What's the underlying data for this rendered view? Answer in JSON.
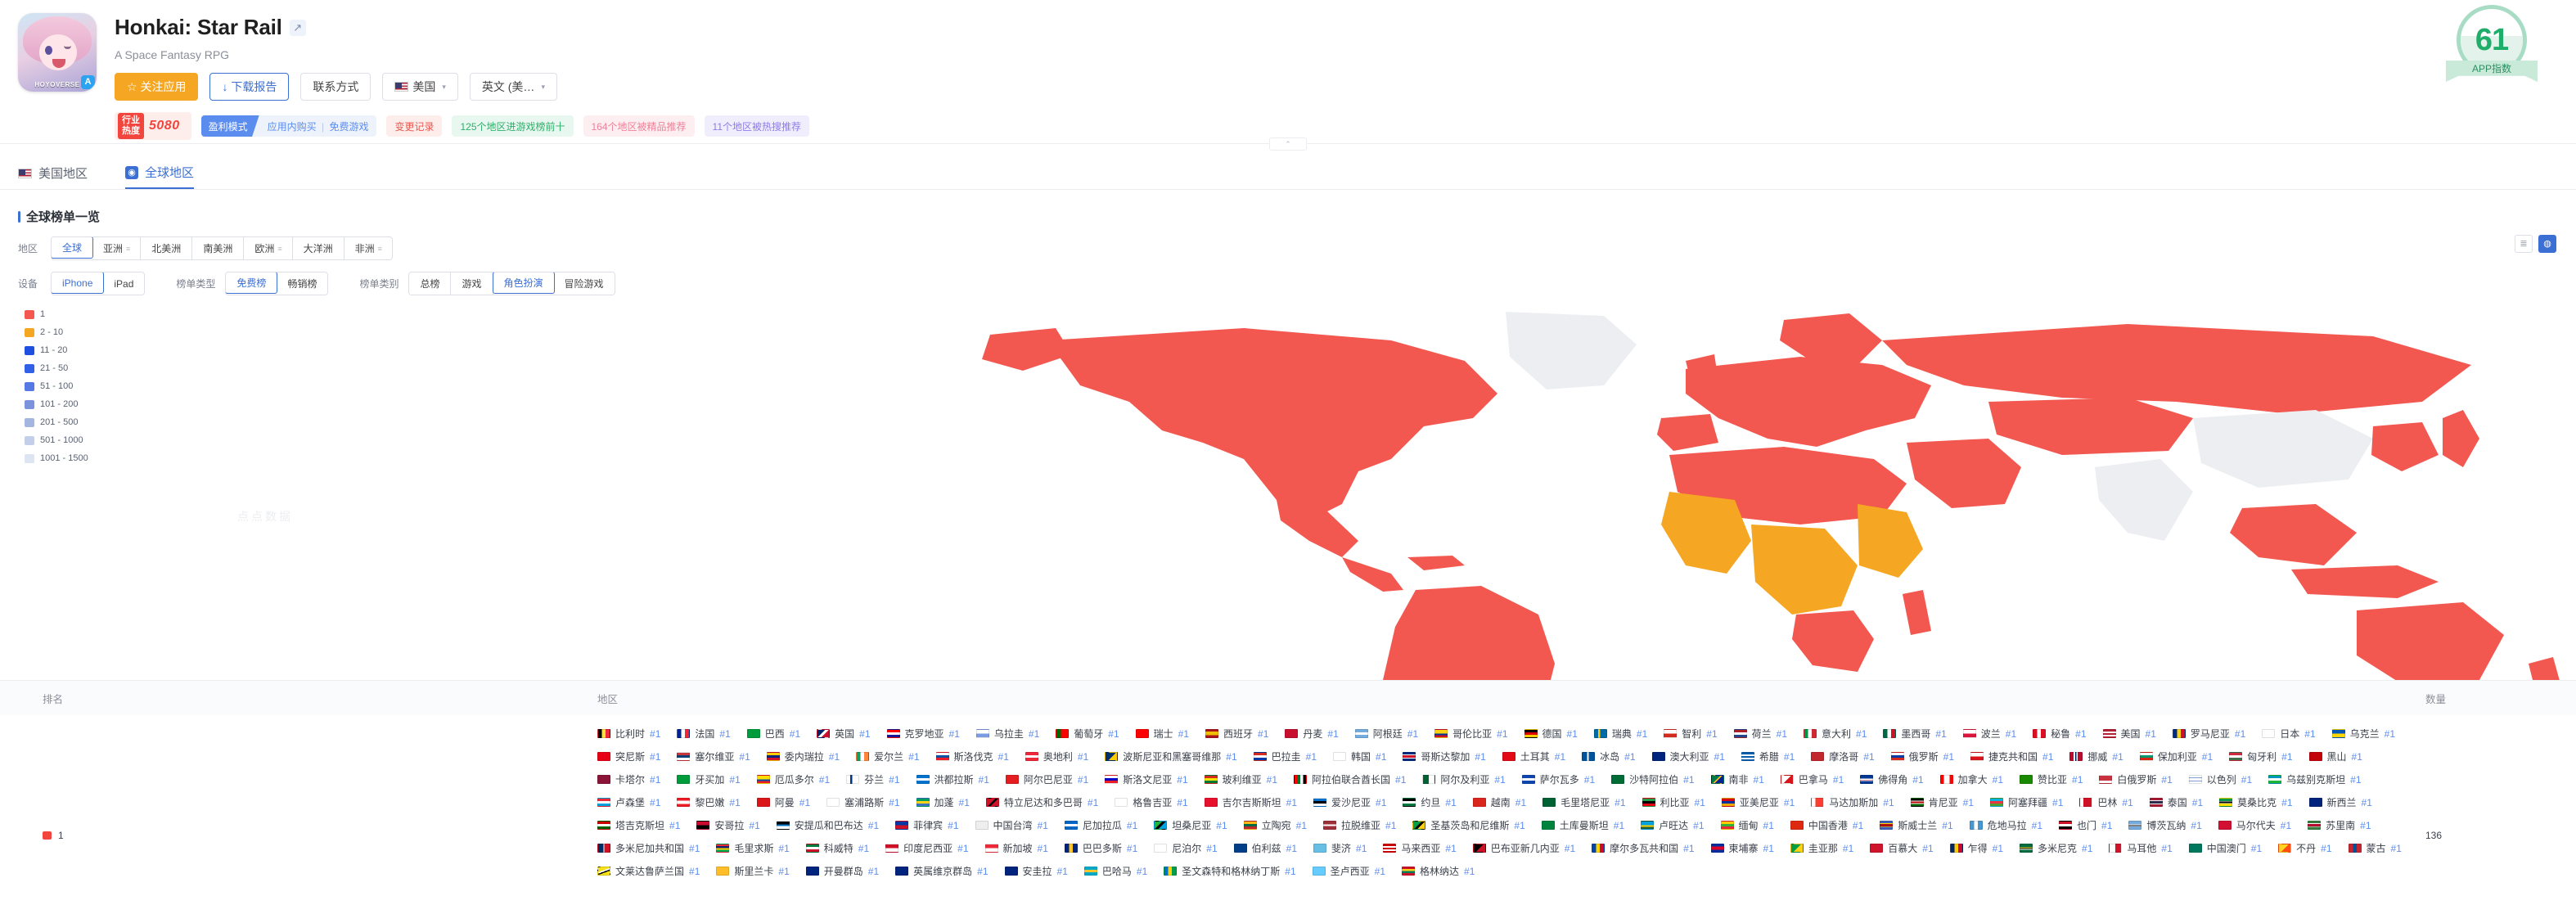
{
  "header": {
    "app_title": "Honkai: Star Rail",
    "external_link_icon": "external-link-icon",
    "subtitle": "A Space Fantasy RPG",
    "icon_brand": "HOYOVERSE",
    "store_badge": "A",
    "buttons": {
      "follow": "☆ 关注应用",
      "download_report": "↓ 下载报告",
      "contact": "联系方式",
      "country": "美国",
      "language": "英文 (美…"
    },
    "heat": {
      "label_top": "行业",
      "label_bottom": "热度",
      "value": "5080"
    },
    "tags": {
      "monetization_key": "盈利模式",
      "monetization_val_1": "应用内购买",
      "monetization_sep": "|",
      "monetization_val_2": "免费游戏",
      "changelog": "变更记录",
      "top_ten": "125个地区进游戏榜前十",
      "featured": "164个地区被精品推荐",
      "trending": "11个地区被热搜推荐"
    },
    "score": {
      "value": "61",
      "label": "APP指数"
    },
    "collapse": "⌃"
  },
  "region_tabs": [
    {
      "label": "美国地区",
      "icon": "us-flag-icon",
      "active": false
    },
    {
      "label": "全球地区",
      "icon": "globe-icon",
      "active": true
    }
  ],
  "section": {
    "title": "全球榜单一览"
  },
  "filters": {
    "region": {
      "label": "地区",
      "options": [
        {
          "label": "全球",
          "active": true,
          "has_menu": false
        },
        {
          "label": "亚洲",
          "active": false,
          "has_menu": true
        },
        {
          "label": "北美洲",
          "active": false,
          "has_menu": false
        },
        {
          "label": "南美洲",
          "active": false,
          "has_menu": false
        },
        {
          "label": "欧洲",
          "active": false,
          "has_menu": true
        },
        {
          "label": "大洋洲",
          "active": false,
          "has_menu": false
        },
        {
          "label": "非洲",
          "active": false,
          "has_menu": true
        }
      ]
    },
    "device": {
      "label": "设备",
      "options": [
        {
          "label": "iPhone",
          "active": true
        },
        {
          "label": "iPad",
          "active": false
        }
      ]
    },
    "chart_type": {
      "label": "榜单类型",
      "options": [
        {
          "label": "免费榜",
          "active": true
        },
        {
          "label": "畅销榜",
          "active": false
        }
      ]
    },
    "chart_category": {
      "label": "榜单类别",
      "options": [
        {
          "label": "总榜",
          "active": false
        },
        {
          "label": "游戏",
          "active": false
        },
        {
          "label": "角色扮演",
          "active": true
        },
        {
          "label": "冒险游戏",
          "active": false
        }
      ]
    },
    "view_toggle": [
      {
        "icon": "list-view-icon",
        "active": false
      },
      {
        "icon": "map-view-icon",
        "active": true
      }
    ]
  },
  "map": {
    "watermark": "点点数据",
    "legend": [
      {
        "label": "1",
        "color": "#f2584f"
      },
      {
        "label": "2 - 10",
        "color": "#f5a623"
      },
      {
        "label": "11 - 20",
        "color": "#1f4fe0"
      },
      {
        "label": "21 - 50",
        "color": "#3160e8"
      },
      {
        "label": "51 - 100",
        "color": "#5578e4"
      },
      {
        "label": "101 - 200",
        "color": "#7b93dd"
      },
      {
        "label": "201 - 500",
        "color": "#a4b5e0"
      },
      {
        "label": "501 - 1000",
        "color": "#c3cfea"
      },
      {
        "label": "1001 - 1500",
        "color": "#dde4f2"
      }
    ]
  },
  "table": {
    "columns": {
      "rank": "排名",
      "region": "地区",
      "count": "数量"
    },
    "rows": [
      {
        "rank": "1",
        "rank_color": "#f2453d",
        "count": "136",
        "regions": [
          {
            "name": "比利时",
            "rank": "#1",
            "flag": "be"
          },
          {
            "name": "法国",
            "rank": "#1",
            "flag": "fr"
          },
          {
            "name": "巴西",
            "rank": "#1",
            "flag": "br"
          },
          {
            "name": "英国",
            "rank": "#1",
            "flag": "gb"
          },
          {
            "name": "克罗地亚",
            "rank": "#1",
            "flag": "hr"
          },
          {
            "name": "乌拉圭",
            "rank": "#1",
            "flag": "uy"
          },
          {
            "name": "葡萄牙",
            "rank": "#1",
            "flag": "pt"
          },
          {
            "name": "瑞士",
            "rank": "#1",
            "flag": "ch"
          },
          {
            "name": "西班牙",
            "rank": "#1",
            "flag": "es"
          },
          {
            "name": "丹麦",
            "rank": "#1",
            "flag": "dk"
          },
          {
            "name": "阿根廷",
            "rank": "#1",
            "flag": "ar"
          },
          {
            "name": "哥伦比亚",
            "rank": "#1",
            "flag": "co"
          },
          {
            "name": "德国",
            "rank": "#1",
            "flag": "de"
          },
          {
            "name": "瑞典",
            "rank": "#1",
            "flag": "se"
          },
          {
            "name": "智利",
            "rank": "#1",
            "flag": "cl"
          },
          {
            "name": "荷兰",
            "rank": "#1",
            "flag": "nl"
          },
          {
            "name": "意大利",
            "rank": "#1",
            "flag": "it"
          },
          {
            "name": "墨西哥",
            "rank": "#1",
            "flag": "mx"
          },
          {
            "name": "波兰",
            "rank": "#1",
            "flag": "pl"
          },
          {
            "name": "秘鲁",
            "rank": "#1",
            "flag": "pe"
          },
          {
            "name": "美国",
            "rank": "#1",
            "flag": "us"
          },
          {
            "name": "罗马尼亚",
            "rank": "#1",
            "flag": "ro"
          },
          {
            "name": "日本",
            "rank": "#1",
            "flag": "jp"
          },
          {
            "name": "乌克兰",
            "rank": "#1",
            "flag": "ua"
          },
          {
            "name": "突尼斯",
            "rank": "#1",
            "flag": "tn"
          },
          {
            "name": "塞尔维亚",
            "rank": "#1",
            "flag": "rs"
          },
          {
            "name": "委内瑞拉",
            "rank": "#1",
            "flag": "ve"
          },
          {
            "name": "爱尔兰",
            "rank": "#1",
            "flag": "ie"
          },
          {
            "name": "斯洛伐克",
            "rank": "#1",
            "flag": "sk"
          },
          {
            "name": "奥地利",
            "rank": "#1",
            "flag": "at"
          },
          {
            "name": "波斯尼亚和黑塞哥维那",
            "rank": "#1",
            "flag": "ba"
          },
          {
            "name": "巴拉圭",
            "rank": "#1",
            "flag": "py"
          },
          {
            "name": "韩国",
            "rank": "#1",
            "flag": "kr"
          },
          {
            "name": "哥斯达黎加",
            "rank": "#1",
            "flag": "cr"
          },
          {
            "name": "土耳其",
            "rank": "#1",
            "flag": "tr"
          },
          {
            "name": "冰岛",
            "rank": "#1",
            "flag": "is"
          },
          {
            "name": "澳大利亚",
            "rank": "#1",
            "flag": "au"
          },
          {
            "name": "希腊",
            "rank": "#1",
            "flag": "gr"
          },
          {
            "name": "摩洛哥",
            "rank": "#1",
            "flag": "ma"
          },
          {
            "name": "俄罗斯",
            "rank": "#1",
            "flag": "ru"
          },
          {
            "name": "捷克共和国",
            "rank": "#1",
            "flag": "cz"
          },
          {
            "name": "挪威",
            "rank": "#1",
            "flag": "no"
          },
          {
            "name": "保加利亚",
            "rank": "#1",
            "flag": "bg"
          },
          {
            "name": "匈牙利",
            "rank": "#1",
            "flag": "hu"
          },
          {
            "name": "黑山",
            "rank": "#1",
            "flag": "me"
          },
          {
            "name": "卡塔尔",
            "rank": "#1",
            "flag": "qa"
          },
          {
            "name": "牙买加",
            "rank": "#1",
            "flag": "jm"
          },
          {
            "name": "厄瓜多尔",
            "rank": "#1",
            "flag": "ec"
          },
          {
            "name": "芬兰",
            "rank": "#1",
            "flag": "fi"
          },
          {
            "name": "洪都拉斯",
            "rank": "#1",
            "flag": "hn"
          },
          {
            "name": "阿尔巴尼亚",
            "rank": "#1",
            "flag": "al"
          },
          {
            "name": "斯洛文尼亚",
            "rank": "#1",
            "flag": "si"
          },
          {
            "name": "玻利维亚",
            "rank": "#1",
            "flag": "bo"
          },
          {
            "name": "阿拉伯联合酋长国",
            "rank": "#1",
            "flag": "ae"
          },
          {
            "name": "阿尔及利亚",
            "rank": "#1",
            "flag": "dz"
          },
          {
            "name": "萨尔瓦多",
            "rank": "#1",
            "flag": "sv"
          },
          {
            "name": "沙特阿拉伯",
            "rank": "#1",
            "flag": "sa"
          },
          {
            "name": "南非",
            "rank": "#1",
            "flag": "za"
          },
          {
            "name": "巴拿马",
            "rank": "#1",
            "flag": "pa"
          },
          {
            "name": "佛得角",
            "rank": "#1",
            "flag": "cv"
          },
          {
            "name": "加拿大",
            "rank": "#1",
            "flag": "ca"
          },
          {
            "name": "赞比亚",
            "rank": "#1",
            "flag": "zm"
          },
          {
            "name": "白俄罗斯",
            "rank": "#1",
            "flag": "by"
          },
          {
            "name": "以色列",
            "rank": "#1",
            "flag": "il"
          },
          {
            "name": "乌兹别克斯坦",
            "rank": "#1",
            "flag": "uz"
          },
          {
            "name": "卢森堡",
            "rank": "#1",
            "flag": "lu"
          },
          {
            "name": "黎巴嫩",
            "rank": "#1",
            "flag": "lb"
          },
          {
            "name": "阿曼",
            "rank": "#1",
            "flag": "om"
          },
          {
            "name": "塞浦路斯",
            "rank": "#1",
            "flag": "cy"
          },
          {
            "name": "加蓬",
            "rank": "#1",
            "flag": "ga"
          },
          {
            "name": "特立尼达和多巴哥",
            "rank": "#1",
            "flag": "tt"
          },
          {
            "name": "格鲁吉亚",
            "rank": "#1",
            "flag": "ge"
          },
          {
            "name": "吉尔吉斯斯坦",
            "rank": "#1",
            "flag": "kg"
          },
          {
            "name": "爱沙尼亚",
            "rank": "#1",
            "flag": "ee"
          },
          {
            "name": "约旦",
            "rank": "#1",
            "flag": "jo"
          },
          {
            "name": "越南",
            "rank": "#1",
            "flag": "vn"
          },
          {
            "name": "毛里塔尼亚",
            "rank": "#1",
            "flag": "mr"
          },
          {
            "name": "利比亚",
            "rank": "#1",
            "flag": "ly"
          },
          {
            "name": "亚美尼亚",
            "rank": "#1",
            "flag": "am"
          },
          {
            "name": "马达加斯加",
            "rank": "#1",
            "flag": "mg"
          },
          {
            "name": "肯尼亚",
            "rank": "#1",
            "flag": "ke"
          },
          {
            "name": "阿塞拜疆",
            "rank": "#1",
            "flag": "az"
          },
          {
            "name": "巴林",
            "rank": "#1",
            "flag": "bh"
          },
          {
            "name": "泰国",
            "rank": "#1",
            "flag": "th"
          },
          {
            "name": "莫桑比克",
            "rank": "#1",
            "flag": "mz"
          },
          {
            "name": "新西兰",
            "rank": "#1",
            "flag": "nz"
          },
          {
            "name": "塔吉克斯坦",
            "rank": "#1",
            "flag": "tj"
          },
          {
            "name": "安哥拉",
            "rank": "#1",
            "flag": "ao"
          },
          {
            "name": "安提瓜和巴布达",
            "rank": "#1",
            "flag": "ag"
          },
          {
            "name": "菲律宾",
            "rank": "#1",
            "flag": "ph"
          },
          {
            "name": "中国台湾",
            "rank": "#1",
            "flag": "tw"
          },
          {
            "name": "尼加拉瓜",
            "rank": "#1",
            "flag": "ni"
          },
          {
            "name": "坦桑尼亚",
            "rank": "#1",
            "flag": "tz"
          },
          {
            "name": "立陶宛",
            "rank": "#1",
            "flag": "lt"
          },
          {
            "name": "拉脱维亚",
            "rank": "#1",
            "flag": "lv"
          },
          {
            "name": "圣基茨岛和尼维斯",
            "rank": "#1",
            "flag": "kn"
          },
          {
            "name": "土库曼斯坦",
            "rank": "#1",
            "flag": "tm"
          },
          {
            "name": "卢旺达",
            "rank": "#1",
            "flag": "rw"
          },
          {
            "name": "缅甸",
            "rank": "#1",
            "flag": "mm"
          },
          {
            "name": "中国香港",
            "rank": "#1",
            "flag": "hk"
          },
          {
            "name": "斯威士兰",
            "rank": "#1",
            "flag": "sz"
          },
          {
            "name": "危地马拉",
            "rank": "#1",
            "flag": "gt"
          },
          {
            "name": "也门",
            "rank": "#1",
            "flag": "ye"
          },
          {
            "name": "博茨瓦纳",
            "rank": "#1",
            "flag": "bw"
          },
          {
            "name": "马尔代夫",
            "rank": "#1",
            "flag": "mv"
          },
          {
            "name": "苏里南",
            "rank": "#1",
            "flag": "sr"
          },
          {
            "name": "多米尼加共和国",
            "rank": "#1",
            "flag": "do"
          },
          {
            "name": "毛里求斯",
            "rank": "#1",
            "flag": "mu"
          },
          {
            "name": "科威特",
            "rank": "#1",
            "flag": "kw"
          },
          {
            "name": "印度尼西亚",
            "rank": "#1",
            "flag": "id"
          },
          {
            "name": "新加坡",
            "rank": "#1",
            "flag": "sg"
          },
          {
            "name": "巴巴多斯",
            "rank": "#1",
            "flag": "bb"
          },
          {
            "name": "尼泊尔",
            "rank": "#1",
            "flag": "np"
          },
          {
            "name": "伯利兹",
            "rank": "#1",
            "flag": "bz"
          },
          {
            "name": "斐济",
            "rank": "#1",
            "flag": "fj"
          },
          {
            "name": "马来西亚",
            "rank": "#1",
            "flag": "my"
          },
          {
            "name": "巴布亚新几内亚",
            "rank": "#1",
            "flag": "pg"
          },
          {
            "name": "摩尔多瓦共和国",
            "rank": "#1",
            "flag": "md"
          },
          {
            "name": "柬埔寨",
            "rank": "#1",
            "flag": "kh"
          },
          {
            "name": "圭亚那",
            "rank": "#1",
            "flag": "gy"
          },
          {
            "name": "百慕大",
            "rank": "#1",
            "flag": "bm"
          },
          {
            "name": "乍得",
            "rank": "#1",
            "flag": "td"
          },
          {
            "name": "多米尼克",
            "rank": "#1",
            "flag": "dm"
          },
          {
            "name": "马耳他",
            "rank": "#1",
            "flag": "mt"
          },
          {
            "name": "中国澳门",
            "rank": "#1",
            "flag": "mo"
          },
          {
            "name": "不丹",
            "rank": "#1",
            "flag": "bt"
          },
          {
            "name": "蒙古",
            "rank": "#1",
            "flag": "mn"
          },
          {
            "name": "文莱达鲁萨兰国",
            "rank": "#1",
            "flag": "bn"
          },
          {
            "name": "斯里兰卡",
            "rank": "#1",
            "flag": "lk"
          },
          {
            "name": "开曼群岛",
            "rank": "#1",
            "flag": "ky"
          },
          {
            "name": "英属维京群岛",
            "rank": "#1",
            "flag": "vg"
          },
          {
            "name": "安圭拉",
            "rank": "#1",
            "flag": "ai"
          },
          {
            "name": "巴哈马",
            "rank": "#1",
            "flag": "bs"
          },
          {
            "name": "圣文森特和格林纳丁斯",
            "rank": "#1",
            "flag": "vc"
          },
          {
            "name": "圣卢西亚",
            "rank": "#1",
            "flag": "lc"
          },
          {
            "name": "格林纳达",
            "rank": "#1",
            "flag": "gd"
          }
        ]
      }
    ]
  }
}
